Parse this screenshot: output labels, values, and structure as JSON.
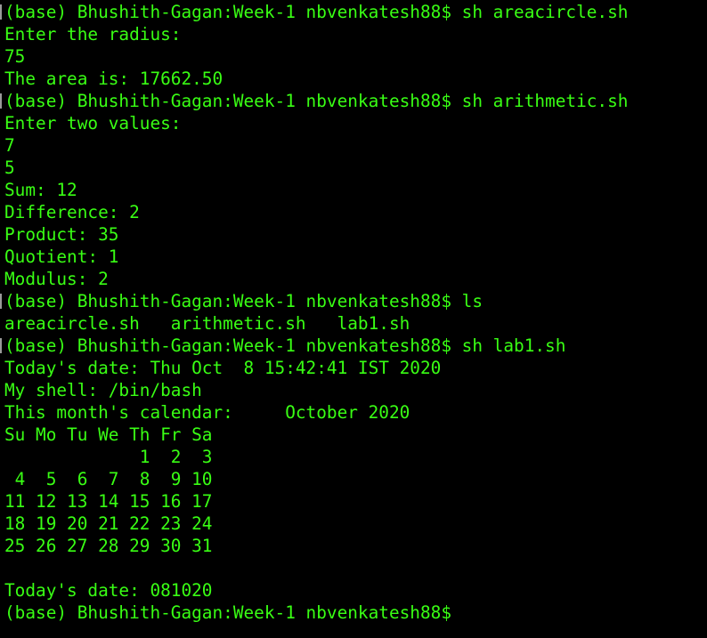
{
  "terminal": {
    "text_color": "#39ff14",
    "background": "#000000",
    "lines": [
      "(base) Bhushith-Gagan:Week-1 nbvenkatesh88$ sh areacircle.sh",
      "Enter the radius:",
      "75",
      "The area is: 17662.50",
      "(base) Bhushith-Gagan:Week-1 nbvenkatesh88$ sh arithmetic.sh",
      "Enter two values:",
      "7",
      "5",
      "Sum: 12",
      "Difference: 2",
      "Product: 35",
      "Quotient: 1",
      "Modulus: 2",
      "(base) Bhushith-Gagan:Week-1 nbvenkatesh88$ ls",
      "areacircle.sh   arithmetic.sh   lab1.sh",
      "(base) Bhushith-Gagan:Week-1 nbvenkatesh88$ sh lab1.sh",
      "Today's date: Thu Oct  8 15:42:41 IST 2020",
      "My shell: /bin/bash",
      "This month's calendar:     October 2020",
      "Su Mo Tu We Th Fr Sa",
      "             1  2  3",
      " 4  5  6  7  8  9 10",
      "11 12 13 14 15 16 17",
      "18 19 20 21 22 23 24",
      "25 26 27 28 29 30 31",
      "",
      "Today's date: 081020",
      "(base) Bhushith-Gagan:Week-1 nbvenkatesh88$"
    ]
  }
}
